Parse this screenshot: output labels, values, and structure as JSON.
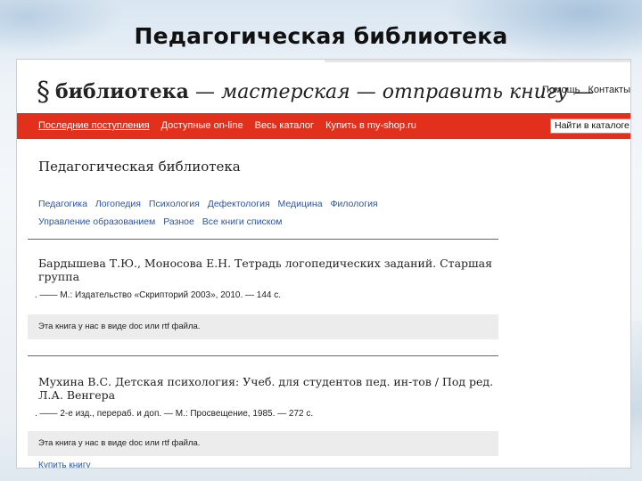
{
  "slide": {
    "title": "Педагогическая библиотека"
  },
  "site": {
    "brand": {
      "symbol": "§",
      "name": "библиотека",
      "dash": "—",
      "workshop": "мастерская",
      "send_book": "отправить книгу"
    },
    "header_links": [
      "Помощь",
      "Контакты"
    ],
    "nav": [
      "Последние поступления",
      "Доступные on-line",
      "Весь каталог",
      "Купить в my-shop.ru"
    ],
    "find_button": "Найти в каталоге"
  },
  "page": {
    "heading": "Педагогическая библиотека",
    "categories_row1": [
      "Педагогика",
      "Логопедия",
      "Психология",
      "Дефектология",
      "Медицина",
      "Филология"
    ],
    "categories_row2": [
      "Управление образованием",
      "Разное",
      "Все книги списком"
    ]
  },
  "books": [
    {
      "title": "Бардышева Т.Ю., Моносова Е.Н. Тетрадь логопедических заданий. Старшая группа",
      "publication": ". —— М.: Издательство «Скрипторий 2003», 2010. — 144 с.",
      "note": "Эта книга у нас в виде doc или rtf файла."
    },
    {
      "title": "Мухина В.С. Детская психология: Учеб. для студентов пед. ин-тов / Под ред. Л.А. Венгера",
      "publication": ". —— 2-е изд., перераб. и доп. — М.: Просвещение, 1985. — 272 с.",
      "note": "Эта книга у нас в виде doc или rtf файла.",
      "buy_link": "Купить книгу"
    }
  ],
  "colors": {
    "accent_red": "#e3301d",
    "link_blue": "#2a55a8"
  }
}
